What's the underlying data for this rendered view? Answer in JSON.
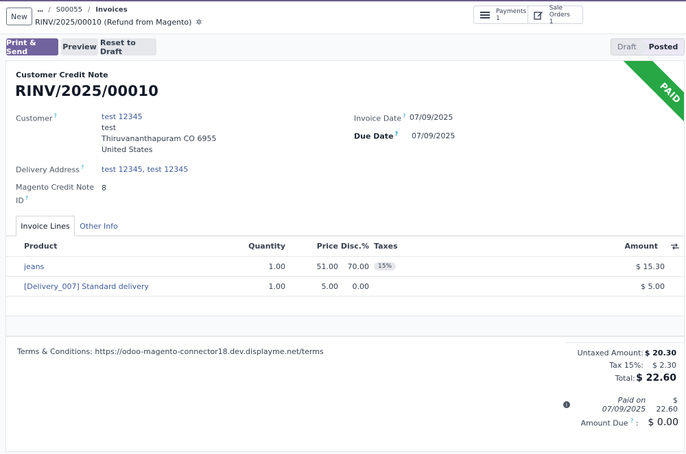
{
  "header": {
    "new_label": "New",
    "breadcrumb_more": "...",
    "breadcrumb_order": "S00055",
    "breadcrumb_current": "Invoices",
    "record_title": "RINV/2025/00010 (Refund from Magento)",
    "stat_buttons": [
      {
        "label": "Payments",
        "count": "1",
        "icon": "list-icon"
      },
      {
        "label": "Sale Orders",
        "count": "1",
        "icon": "edit-icon"
      }
    ]
  },
  "actions": {
    "print_send": "Print & Send",
    "preview": "Preview",
    "reset_draft": "Reset to Draft"
  },
  "status": {
    "draft": "Draft",
    "posted": "Posted",
    "current": "Posted"
  },
  "ribbon": "PAID",
  "document": {
    "type": "Customer Credit Note",
    "name": "RINV/2025/00010"
  },
  "fields": {
    "customer_label": "Customer",
    "customer_name": "test 12345",
    "customer_line2": "test",
    "customer_line3": "Thiruvananthapuram CO 6955",
    "customer_line4": "United States",
    "delivery_label": "Delivery Address",
    "delivery_value": "test 12345, test 12345",
    "magento_label_1": "Magento Credit Note",
    "magento_label_2": "ID",
    "magento_value": "8",
    "invoice_date_label": "Invoice Date",
    "invoice_date_value": "07/09/2025",
    "due_date_label": "Due Date",
    "due_date_value": "07/09/2025",
    "help_mark": "?"
  },
  "tabs": [
    {
      "label": "Invoice Lines",
      "active": true
    },
    {
      "label": "Other Info",
      "active": false
    }
  ],
  "table": {
    "headers": {
      "product": "Product",
      "quantity": "Quantity",
      "price": "Price",
      "disc": "Disc.%",
      "taxes": "Taxes",
      "amount": "Amount"
    },
    "rows": [
      {
        "product": "jeans",
        "quantity": "1.00",
        "price": "51.00",
        "disc": "70.00",
        "taxes": "15%",
        "amount": "$ 15.30"
      },
      {
        "product": "[Delivery_007] Standard delivery",
        "quantity": "1.00",
        "price": "5.00",
        "disc": "0.00",
        "taxes": "",
        "amount": "$ 5.00"
      }
    ]
  },
  "terms": "Terms & Conditions: https://odoo-magento-connector18.dev.displayme.net/terms",
  "totals": {
    "untaxed_label": "Untaxed Amount:",
    "untaxed_value": "$ 20.30",
    "tax_label": "Tax 15%:",
    "tax_value": "$ 2.30",
    "total_label": "Total:",
    "total_value": "$ 22.60",
    "paid_note": "Paid on 07/09/2025",
    "paid_value": "$ 22.60",
    "due_label": "Amount Due",
    "due_value": "$ 0.00"
  },
  "colors": {
    "primary": "#71639e",
    "ribbon": "#28a745",
    "link": "#3d5b9a",
    "help": "#0f9bb5"
  }
}
